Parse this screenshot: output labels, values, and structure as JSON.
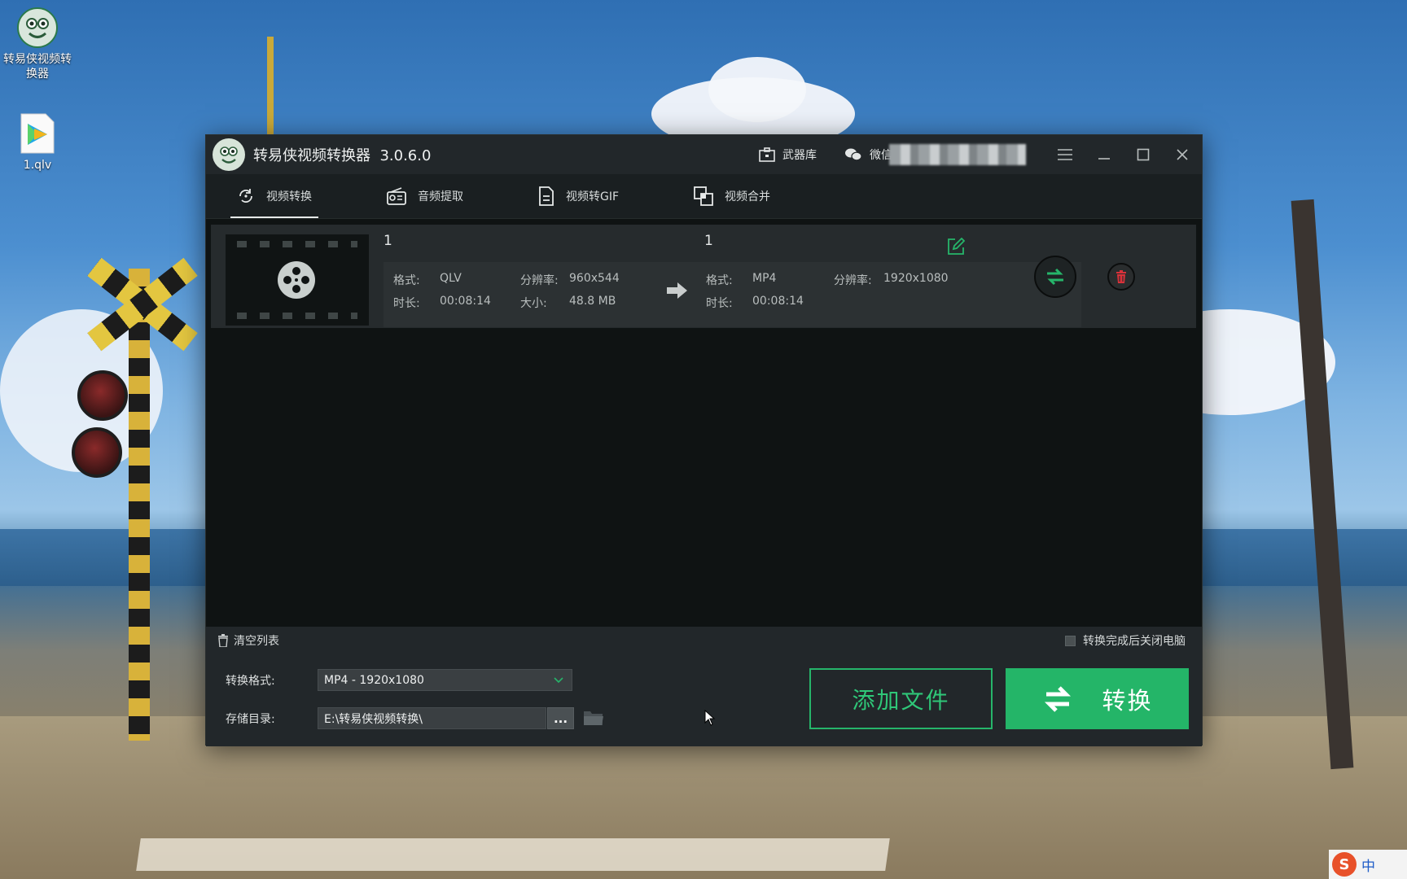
{
  "desktop": {
    "icons": [
      {
        "label": "转易侠视频转换器",
        "icon": "video-converter-app-icon"
      },
      {
        "label": "1.qlv",
        "icon": "tencent-video-file-icon"
      }
    ],
    "ime": {
      "label": "中",
      "badge": "S"
    }
  },
  "window": {
    "title": "转易侠视频转换器",
    "version": "3.0.6.0",
    "toolbar": {
      "arsenal": "武器库",
      "wechat": "微信"
    },
    "tabs": [
      {
        "label": "视频转换",
        "active": true
      },
      {
        "label": "音频提取",
        "active": false
      },
      {
        "label": "视频转GIF",
        "active": false
      },
      {
        "label": "视频合并",
        "active": false
      }
    ],
    "file": {
      "source": {
        "name": "1",
        "format_label": "格式:",
        "format": "QLV",
        "duration_label": "时长:",
        "duration": "00:08:14",
        "resolution_label": "分辨率:",
        "resolution": "960x544",
        "size_label": "大小:",
        "size": "48.8 MB"
      },
      "target": {
        "name": "1",
        "format_label": "格式:",
        "format": "MP4",
        "duration_label": "时长:",
        "duration": "00:08:14",
        "resolution_label": "分辨率:",
        "resolution": "1920x1080"
      }
    },
    "clear_list": "清空列表",
    "shutdown_after": "转换完成后关闭电脑",
    "format_label": "转换格式:",
    "format_value": "MP4 - 1920x1080",
    "output_label": "存储目录:",
    "output_path": "E:\\转易侠视频转换\\",
    "browse": "...",
    "add_files": "添加文件",
    "convert": "转换"
  },
  "colors": {
    "accent": "#24b568",
    "window_bg": "#0f1313",
    "panel_bg": "#22272a",
    "delete": "#d9323a"
  }
}
